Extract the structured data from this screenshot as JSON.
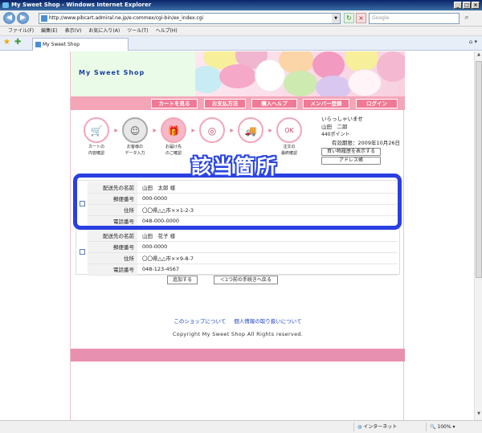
{
  "window": {
    "title": "My Sweet Shop - Windows Internet Explorer",
    "controls": [
      "_",
      "□",
      "×"
    ]
  },
  "address": {
    "url": "http://www.pibcart.admiral.ne.jp/e-commex/cgi-bin/ex_index.cgi",
    "search_placeholder": "Google"
  },
  "menu": [
    "ファイル(F)",
    "編集(E)",
    "表示(V)",
    "お気に入り(A)",
    "ツール(T)",
    "ヘルプ(H)"
  ],
  "tab": {
    "label": "My Sweet Shop"
  },
  "shop": {
    "logo": "My Sweet Shop",
    "nav": [
      "カートを見る",
      "お支払方法",
      "購入ヘルプ",
      "メンバー登録",
      "ログイン"
    ],
    "steps": [
      {
        "label1": "カートの",
        "label2": "内容確認",
        "icon": "cart-icon",
        "state": "normal"
      },
      {
        "label1": "お客様の",
        "label2": "データ入力",
        "icon": "user-icon",
        "state": "gray"
      },
      {
        "label1": "お届け先",
        "label2": "のご確認",
        "icon": "gift-icon",
        "state": "active"
      },
      {
        "label1": "",
        "label2": "",
        "icon": "ring-icon",
        "state": "normal"
      },
      {
        "label1": "",
        "label2": "",
        "icon": "truck-icon",
        "state": "normal"
      },
      {
        "label1": "注文の",
        "label2": "最終確認",
        "icon": "ok-icon",
        "state": "normal"
      }
    ],
    "user": {
      "greeting": "いらっしゃいませ",
      "name": "山田　二郎",
      "points": "440ポイント",
      "expiry": "有効期限：2009年10月26日",
      "history_button": "買い物履歴を表示する",
      "address_book_button": "アドレス帳"
    },
    "highlight_label": "該当箇所",
    "addresses": [
      {
        "name_key": "配送先の名前",
        "name": "山田　太郎 様",
        "zip_key": "郵便番号",
        "zip": "000-0000",
        "addr_key": "住所",
        "addr": "〇〇県△△市××1-2-3",
        "tel_key": "電話番号",
        "tel": "048-000-0000"
      },
      {
        "name_key": "配送先の名前",
        "name": "山田　花子 様",
        "zip_key": "郵便番号",
        "zip": "000-0000",
        "addr_key": "住所",
        "addr": "〇〇県△△市××9-8-7",
        "tel_key": "電話番号",
        "tel": "048-123-4567"
      }
    ],
    "add_button": "追加する",
    "back_button": "＜1つ前の手続きへ戻る",
    "footer_links": [
      "このショップについて",
      "個人情報の取り扱いについて"
    ],
    "copyright": "Copyright My Sweet Shop All Rights reserved."
  },
  "status": {
    "zone": "インターネット",
    "zoom": "100%"
  },
  "colors": {
    "accent_blue": "#2a3fe0",
    "pink": "#f07a96",
    "footer_pink": "#e890b0"
  }
}
